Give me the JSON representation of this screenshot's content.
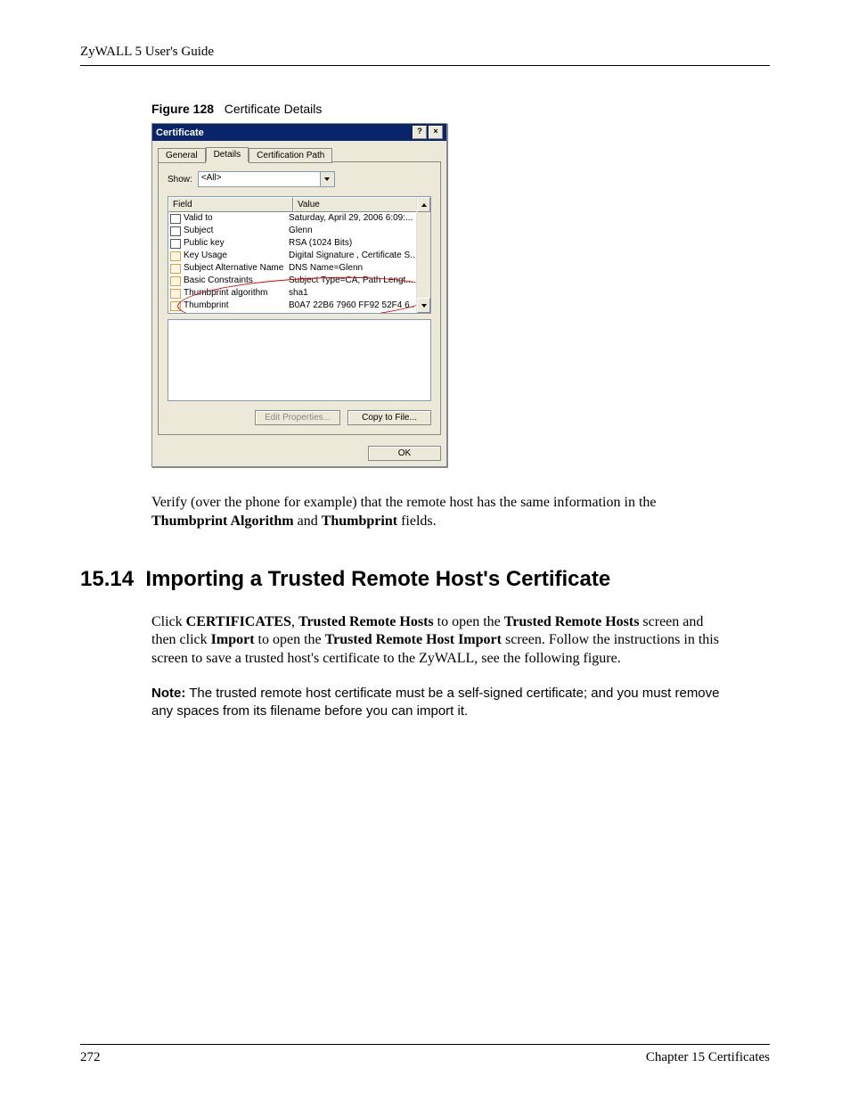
{
  "header": {
    "guide_title": "ZyWALL 5 User's Guide"
  },
  "figure": {
    "label": "Figure 128",
    "title": "Certificate Details"
  },
  "dialog": {
    "title": "Certificate",
    "help_label": "?",
    "close_label": "×",
    "tabs": {
      "general": "General",
      "details": "Details",
      "certpath": "Certification Path"
    },
    "show_label": "Show:",
    "show_value": "<All>",
    "col_field": "Field",
    "col_value": "Value",
    "rows": [
      {
        "icon": "detail",
        "field": "Valid to",
        "value": "Saturday, April 29, 2006 6:09:..."
      },
      {
        "icon": "detail",
        "field": "Subject",
        "value": "Glenn"
      },
      {
        "icon": "detail",
        "field": "Public key",
        "value": "RSA (1024 Bits)"
      },
      {
        "icon": "ext",
        "field": "Key Usage",
        "value": "Digital Signature , Certificate S..."
      },
      {
        "icon": "ext",
        "field": "Subject Alternative Name",
        "value": "DNS Name=Glenn"
      },
      {
        "icon": "ext",
        "field": "Basic Constraints",
        "value": "Subject Type=CA, Path Lengt..."
      },
      {
        "icon": "ext",
        "field": "Thumbprint algorithm",
        "value": "sha1"
      },
      {
        "icon": "ext",
        "field": "Thumbprint",
        "value": "B0A7 22B6 7960 FF92 52F4 6..."
      }
    ],
    "edit_btn": "Edit Properties...",
    "copy_btn": "Copy to File...",
    "ok_btn": "OK"
  },
  "verify_text": {
    "pre": "Verify (over the phone for example) that the remote host has the same information in the ",
    "bold1": "Thumbprint Algorithm",
    "mid": " and ",
    "bold2": "Thumbprint",
    "post": " fields."
  },
  "section": {
    "number": "15.14",
    "title": "Importing a Trusted Remote Host's Certificate"
  },
  "para": {
    "p1": "Click ",
    "b1": "CERTIFICATES",
    "p2": ", ",
    "b2": "Trusted Remote Hosts",
    "p3": " to open the ",
    "b3": "Trusted Remote Hosts",
    "p4": " screen and then click ",
    "b4": "Import",
    "p5": " to open the ",
    "b5": "Trusted Remote Host Import",
    "p6": " screen. Follow the instructions in this screen to save a trusted host's certificate to the ZyWALL, see the following figure."
  },
  "note": {
    "label": "Note:",
    "text": " The trusted remote host certificate must be a self-signed certificate; and you must remove any spaces from its filename before you can import it."
  },
  "footer": {
    "page": "272",
    "chapter": "Chapter 15 Certificates"
  }
}
